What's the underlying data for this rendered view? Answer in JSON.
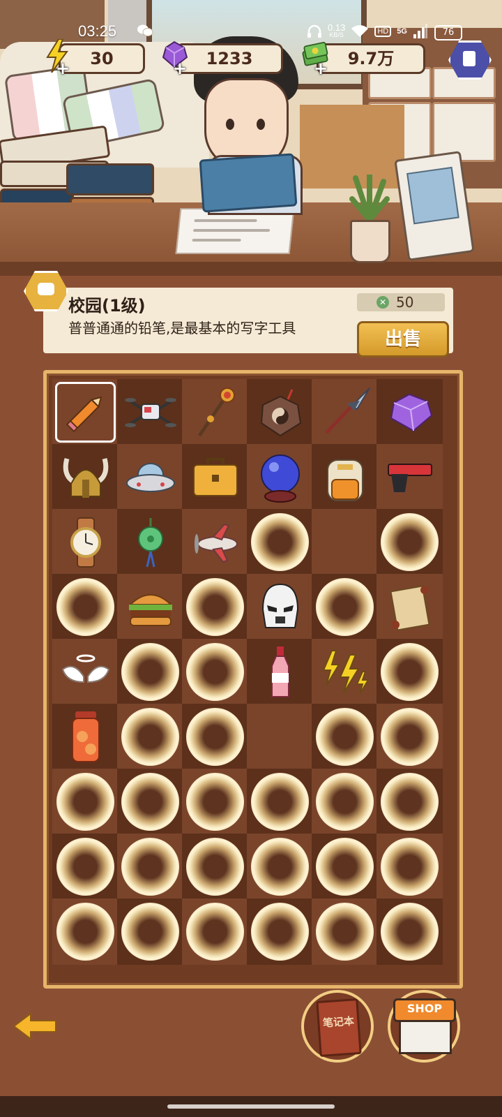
{
  "status_bar": {
    "time": "03:25",
    "net_speed_value": "0.13",
    "net_speed_unit": "KB/S",
    "hd_label": "HD",
    "network_label": "5G",
    "battery": "76"
  },
  "currencies": {
    "energy": "30",
    "gems": "1233",
    "cash": "9.7万"
  },
  "item_info": {
    "name": "校园(1级)",
    "description": "普普通通的铅笔,是最基本的写字工具",
    "price": "50",
    "sell_label": "出售"
  },
  "bottom": {
    "notebook_label": "笔记本",
    "shop_label": "SHOP"
  },
  "board": {
    "columns": 6,
    "rows": 9,
    "cells": [
      "pencil",
      "drone",
      "staff",
      "bagua",
      "spear",
      "gem",
      "viking-helmet",
      "ufo",
      "briefcase",
      "crystal-ball",
      "backpack",
      "pistol",
      "watch",
      "jade-pendant",
      "plane",
      "locked",
      "empty",
      "locked",
      "locked",
      "burger",
      "locked",
      "stormtrooper-helmet",
      "locked",
      "scroll",
      "angel-wings",
      "locked",
      "locked",
      "soda-bottle",
      "lightning",
      "locked",
      "juice-jar",
      "locked",
      "locked",
      "empty",
      "locked",
      "locked",
      "locked",
      "locked",
      "locked",
      "locked",
      "locked",
      "locked",
      "locked",
      "locked",
      "locked",
      "locked",
      "locked",
      "locked",
      "locked",
      "locked",
      "locked",
      "locked",
      "locked",
      "locked"
    ],
    "selected_index": 0
  },
  "colors": {
    "board_bg": "#6f3b22",
    "board_border": "#e6b56a",
    "sell_button": "#e2ad3e",
    "info_panel": "#f5ead5"
  }
}
